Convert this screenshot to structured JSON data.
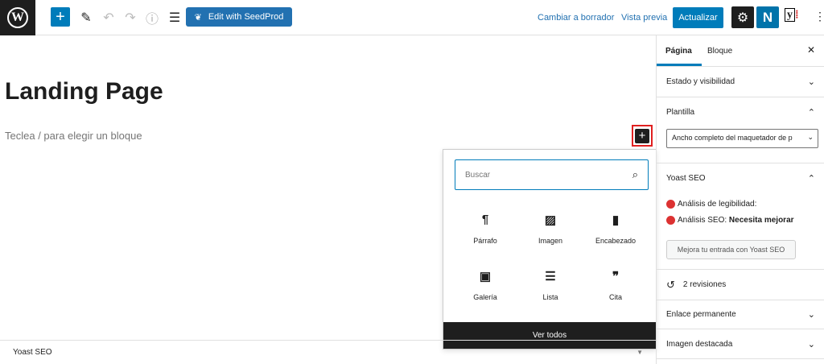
{
  "topbar": {
    "wp_logo": "W",
    "seedprod": "Edit with SeedProd",
    "switch_draft": "Cambiar a borrador",
    "preview": "Vista previa",
    "update": "Actualizar",
    "n_plugin": "N",
    "yoast": "y"
  },
  "editor": {
    "title": "Landing Page",
    "hint": "Teclea / para elegir un bloque"
  },
  "inserter": {
    "search_placeholder": "Buscar",
    "blocks": [
      {
        "icon": "¶",
        "label": "Párrafo"
      },
      {
        "icon": "▨",
        "label": "Imagen"
      },
      {
        "icon": "▮",
        "label": "Encabezado"
      },
      {
        "icon": "▣",
        "label": "Galería"
      },
      {
        "icon": "☰",
        "label": "Lista"
      },
      {
        "icon": "❞",
        "label": "Cita"
      }
    ],
    "view_all": "Ver todos"
  },
  "bottom": {
    "label": "Yoast SEO"
  },
  "sidebar": {
    "tabs": [
      "Página",
      "Bloque"
    ],
    "status": "Estado y visibilidad",
    "template": "Plantilla",
    "template_value": "Ancho completo del maquetador de p",
    "yoast": "Yoast SEO",
    "readability": "Análisis de legibilidad:",
    "seo_label": "Análisis SEO:",
    "seo_value": "Necesita mejorar",
    "improve": "Mejora tu entrada con Yoast SEO",
    "revisions": "2 revisiones",
    "permalink": "Enlace permanente",
    "featured": "Imagen destacada"
  },
  "colors": {
    "accent": "#007cba",
    "danger": "#dc3232"
  }
}
